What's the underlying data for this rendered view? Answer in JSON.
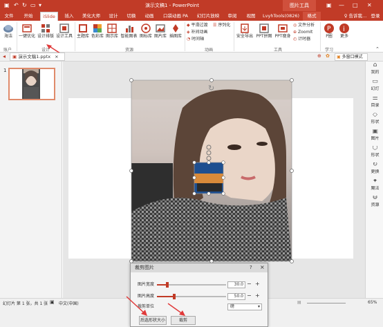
{
  "titlebar": {
    "title": "演示文稿1 - PowerPoint",
    "context_group": "图片工具",
    "user": "登录"
  },
  "tabs": [
    "文件",
    "开始",
    "iSlide",
    "插入",
    "美化大师",
    "设计",
    "切换",
    "动画",
    "口袋动画 PA",
    "幻灯片放映",
    "审阅",
    "视图",
    "LvyhTools(0826)",
    "格式"
  ],
  "tell_me": "♀ 告诉我...",
  "ribbon": {
    "account_btn": "海洁",
    "account_group": "账户",
    "design": {
      "items": [
        "一键优化",
        "设计排版",
        "设计工具"
      ],
      "group": "设计"
    },
    "resources": {
      "items": [
        "主题库",
        "色彩库",
        "图示库",
        "智能图表",
        "图标库",
        "图片库",
        "插图库"
      ],
      "group": "资源"
    },
    "animation": {
      "items": [
        "平滑过渡",
        "补间动画",
        "时间轴"
      ],
      "extra": "序列化",
      "group": "动画"
    },
    "tools": {
      "items": [
        "安全导出",
        "PPT拼图",
        "PPT瘦身"
      ],
      "small": [
        "文件分析",
        "ZoomIt",
        "计时器"
      ],
      "group": "工具"
    },
    "learn": {
      "items": [
        "P圈",
        "更多"
      ],
      "group": "学习"
    }
  },
  "doc_tab": {
    "name": "演示文稿1.pptx",
    "close": "×",
    "mode": "多窗口模式"
  },
  "slide_number": "1",
  "right_panel": [
    "我的",
    "幻灯",
    "目录",
    "形状",
    "图片",
    "形状",
    "更换",
    "魔法",
    "资源"
  ],
  "status": {
    "slide_info": "幻灯片 第 1 张，共 1 张",
    "language": "中文(中国)",
    "zoom": "65%"
  },
  "dialog": {
    "title": "裁剪图片",
    "help": "?",
    "close": "×",
    "width_label": "图片宽度",
    "width_value": "30.0",
    "height_label": "图片高度",
    "height_value": "50.0",
    "unit_label": "裁剪单位",
    "unit_value": "磅",
    "btn_fit": "后选形状大小",
    "btn_crop": "裁剪"
  },
  "colors": {
    "accent": "#c13b27",
    "context": "#d0503c",
    "selection": "#e03a3a"
  }
}
